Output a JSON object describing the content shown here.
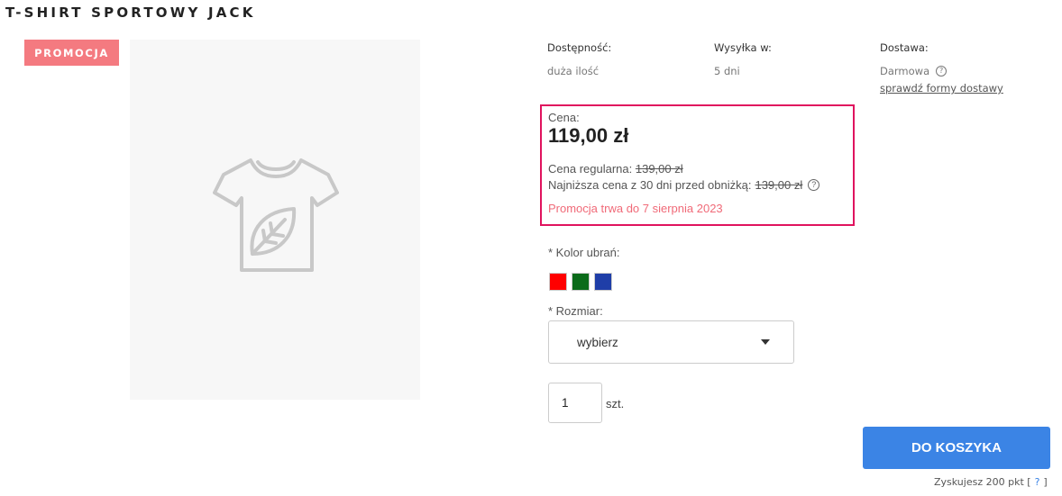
{
  "product": {
    "title": "T-SHIRT SPORTOWY JACK",
    "badge": "PROMOCJA"
  },
  "info": {
    "availability": {
      "label": "Dostępność:",
      "value": "duża ilość"
    },
    "shipping": {
      "label": "Wysyłka w:",
      "value": "5 dni"
    },
    "delivery": {
      "label": "Dostawa:",
      "value": "Darmowa",
      "link": "sprawdź formy dostawy"
    }
  },
  "price": {
    "label": "Cena:",
    "value": "119,00 zł",
    "regular_label": "Cena regularna:",
    "regular_value": "139,00 zł",
    "lowest_label": "Najniższa cena z 30 dni przed obniżką:",
    "lowest_value": "139,00 zł",
    "promo_until": "Promocja trwa do 7 sierpnia 2023"
  },
  "color": {
    "label": "* Kolor ubrań:",
    "swatches": [
      "#ff0000",
      "#0b6b1a",
      "#1f3ea8"
    ]
  },
  "size": {
    "label": "* Rozmiar:",
    "selected": "wybierz"
  },
  "quantity": {
    "value": "1",
    "unit": "szt."
  },
  "cart": {
    "button": "DO KOSZYKA",
    "points_text": "Zyskujesz 200 pkt [",
    "points_help": "?",
    "points_close": "]"
  },
  "icons": {
    "placeholder": "tshirt-leaf-icon",
    "help": "help-icon",
    "dropdown": "chevron-down-icon"
  },
  "colors": {
    "badge": "#f47a80",
    "price_border": "#e0135e",
    "promo_text": "#f06a78",
    "cart_button": "#3b84e5"
  }
}
